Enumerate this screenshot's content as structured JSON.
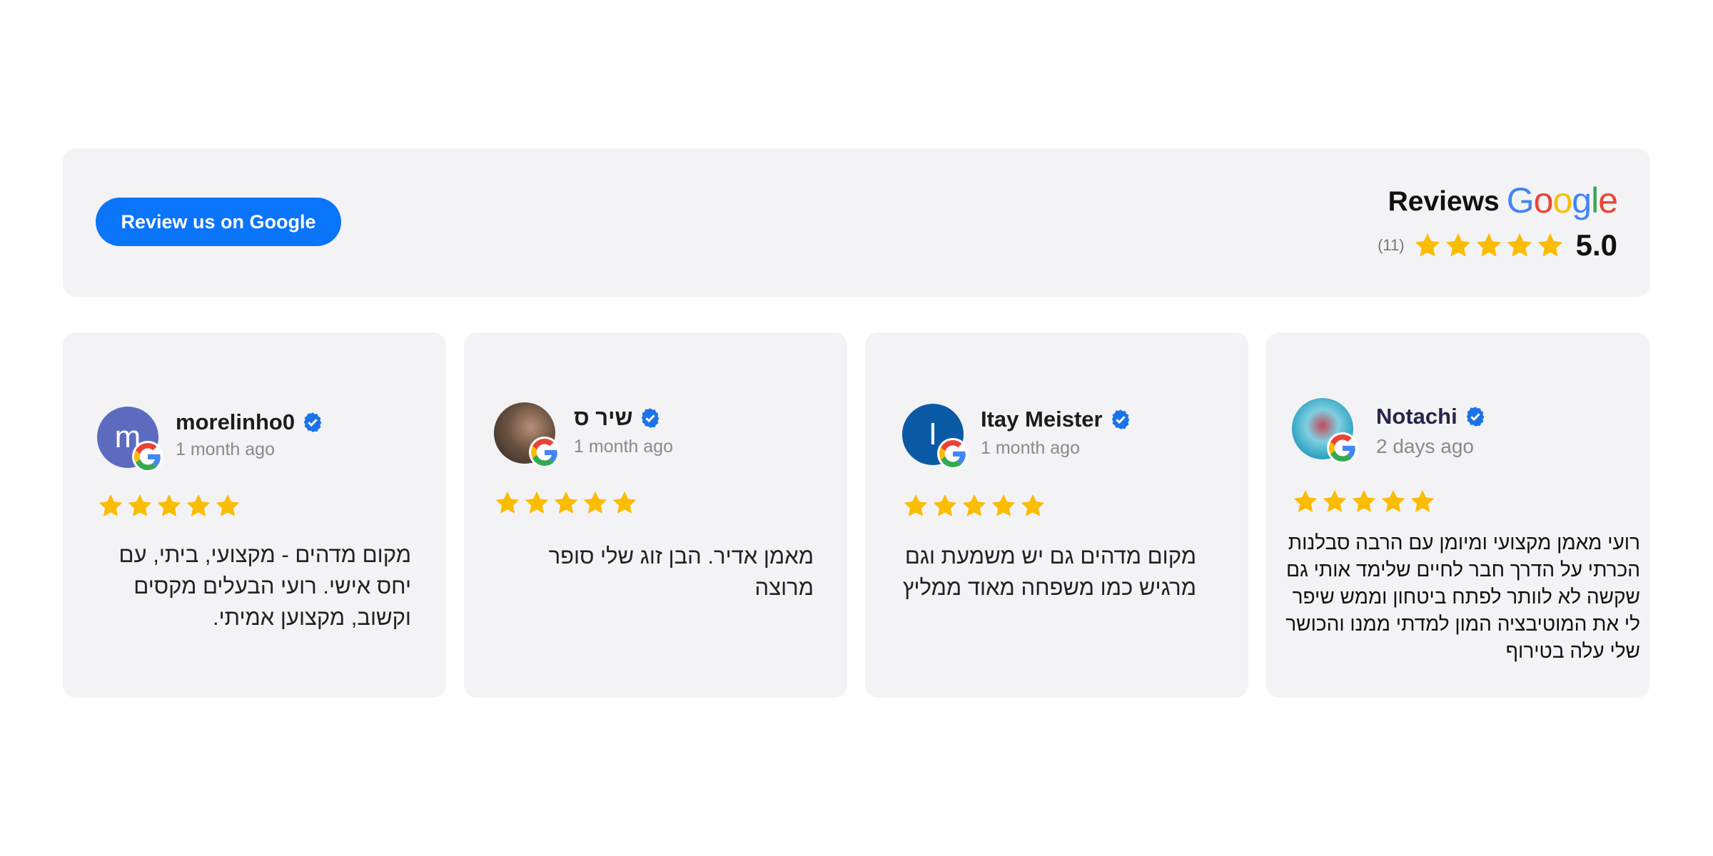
{
  "summary": {
    "button_label": "Review us on Google",
    "title": "Reviews",
    "logo_text": "Google",
    "count": "(11)",
    "score": "5.0",
    "stars": 5
  },
  "colors": {
    "button": "#0a74fb",
    "star": "#fbbc04",
    "verified": "#1a73e8",
    "card_bg": "#f3f3f5",
    "google_blue": "#4285F4",
    "google_red": "#EA4335",
    "google_yellow": "#FBBC05",
    "google_green": "#34A853"
  },
  "reviews": [
    {
      "name": "morelinho0",
      "date": "1 month ago",
      "rating": 5,
      "avatar": {
        "type": "letter",
        "letter": "m",
        "color": "#5c6bc0"
      },
      "text": "מקום מדהים - מקצועי, ביתי, עם יחס אישי. רועי הבעלים מקסים וקשוב, מקצוען אמיתי."
    },
    {
      "name": "שיר ס",
      "date": "1 month ago",
      "rating": 5,
      "avatar": {
        "type": "photo",
        "color": "#6b5240"
      },
      "text": "מאמן אדיר. הבן זוג שלי סופר מרוצה"
    },
    {
      "name": "Itay Meister",
      "date": "1 month ago",
      "rating": 5,
      "avatar": {
        "type": "letter",
        "letter": "I",
        "color": "#0b5aa6"
      },
      "text": "מקום מדהים גם יש משמעת וגם מרגיש כמו משפחה מאוד ממליץ"
    },
    {
      "name": "Notachi",
      "date": "2 days ago",
      "rating": 5,
      "avatar": {
        "type": "photo",
        "color": "#3fb4cc"
      },
      "text": "רועי מאמן מקצועי ומיומן עם הרבה סבלנות הכרתי על הדרך חבר לחיים שלימד אותי גם שקשה לא לוותר לפתח ביטחון וממש שיפר לי את המוטיבציה המון למדתי ממנו והכושר שלי עלה בטירוף"
    }
  ]
}
